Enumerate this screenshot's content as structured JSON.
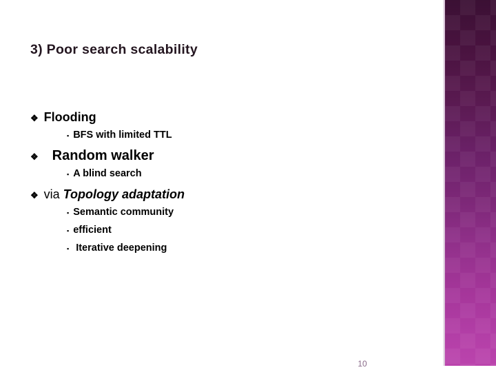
{
  "slide": {
    "title": "3) Poor search scalability",
    "page_number": "10",
    "markers": {
      "level1": "❖",
      "level2": "▪"
    },
    "bullets": [
      {
        "level": 1,
        "text": "Flooding",
        "name": "bullet-flooding"
      },
      {
        "level": 2,
        "text": "BFS with limited TTL",
        "name": "bullet-bfs-with-limited-ttl"
      },
      {
        "level": 1,
        "text": "Random walker",
        "name": "bullet-random-walker"
      },
      {
        "level": 2,
        "text": "A blind search",
        "name": "bullet-a-blind-search"
      },
      {
        "level": 1,
        "text_plain": "via ",
        "text_emphasis": "Topology adaptation",
        "name": "bullet-via-topology-adaptation"
      },
      {
        "level": 2,
        "text": "Semantic community",
        "name": "bullet-semantic-community"
      },
      {
        "level": 2,
        "text": "efficient",
        "name": "bullet-efficient"
      },
      {
        "level": 2,
        "text": " Iterative deepening",
        "name": "bullet-iterative-deepening"
      }
    ]
  },
  "theme": {
    "background": "#ffffff",
    "title_color": "#241620",
    "body_color": "#000000",
    "page_number_color": "#8a6b8a",
    "band_top_color": "#3b1034",
    "band_bottom_color": "#bb44ad"
  }
}
